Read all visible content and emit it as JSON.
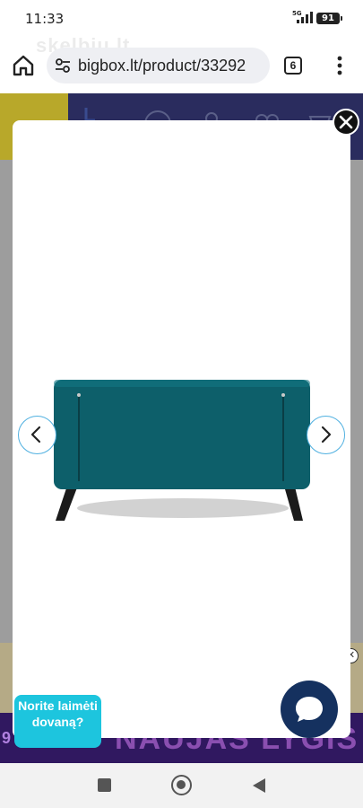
{
  "status_bar": {
    "time": "11:33",
    "network": "5G",
    "battery": "91"
  },
  "browser": {
    "watermark": "skelbiu.lt",
    "url": "bigbox.lt/product/33292",
    "tab_count": "6",
    "icons": [
      "home-icon",
      "site-settings-icon",
      "tab-switcher-icon",
      "more-vert-icon"
    ]
  },
  "background_page": {
    "banner_prefix": "9 S",
    "banner_text": "NAUJAS LYGIS"
  },
  "gallery": {
    "product_image": "teal-sofa-back-view",
    "product_color": "#0d5f6a",
    "icons": [
      "close-icon",
      "chevron-left-icon",
      "chevron-right-icon"
    ]
  },
  "widgets": {
    "promo_bubble": "Norite laimėti dovaną?",
    "chat_icon": "chat-bubble-icon",
    "accent_color": "#1dc5de",
    "chat_color": "#15315f"
  },
  "system_nav": {
    "icons": [
      "recent-apps-icon",
      "home-circle-icon",
      "back-triangle-icon"
    ]
  }
}
